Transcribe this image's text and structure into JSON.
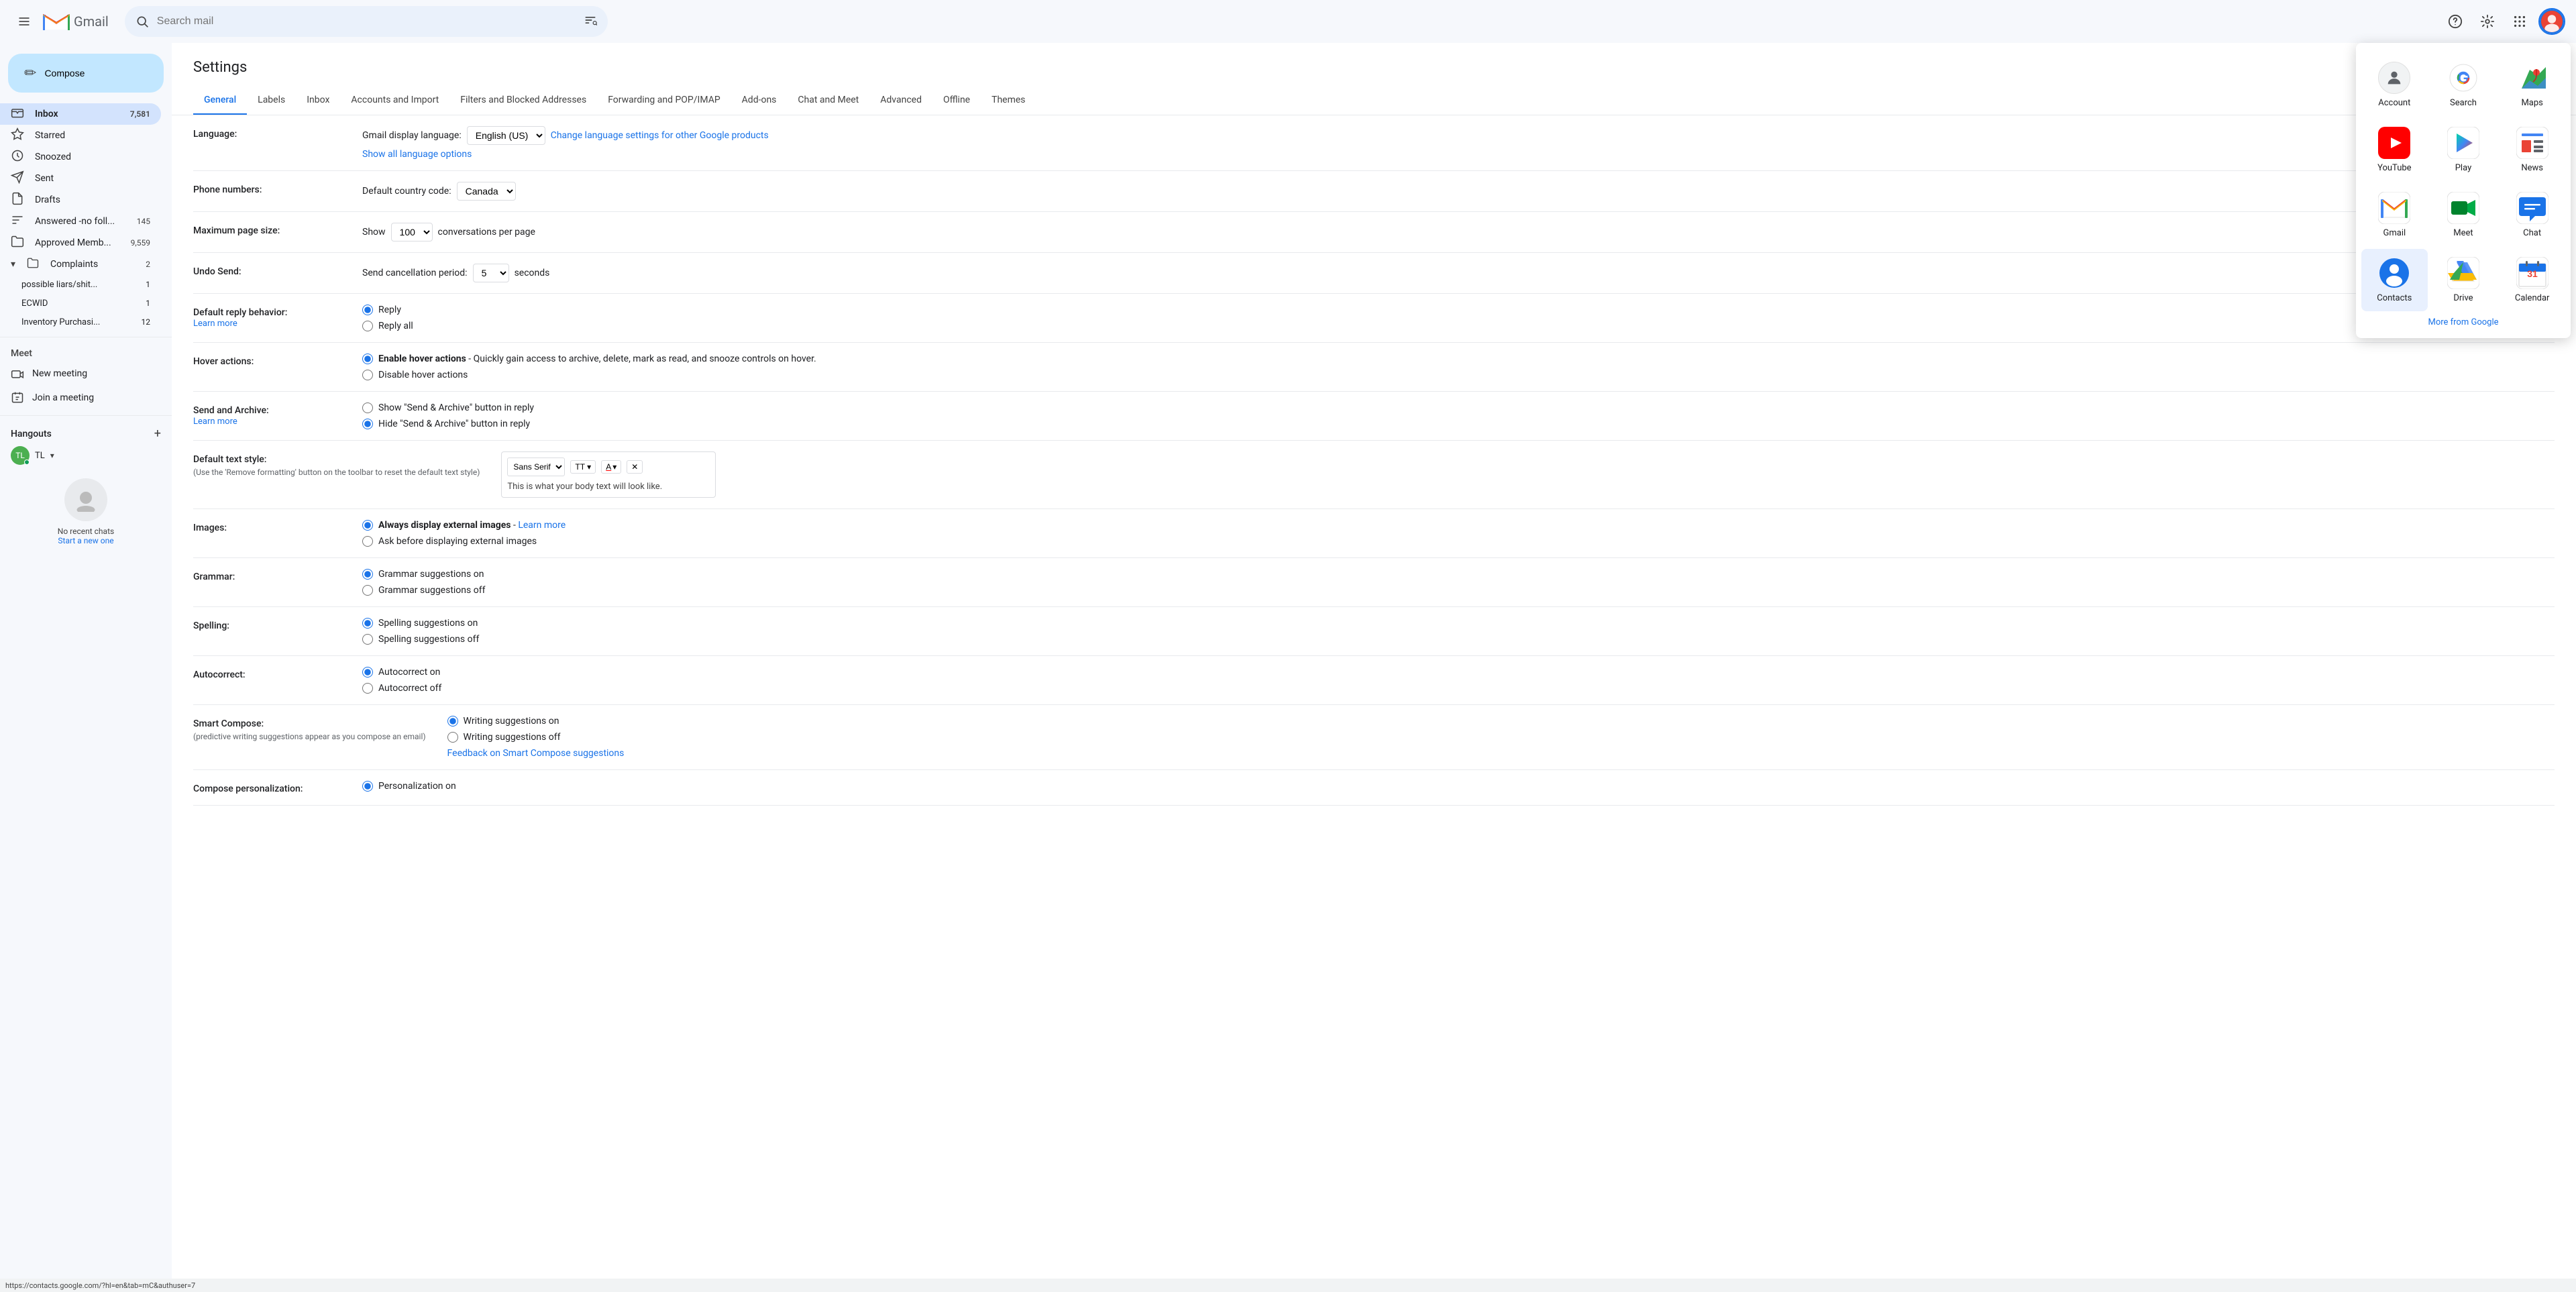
{
  "app": {
    "title": "Gmail",
    "status_bar": "https://contacts.google.com/?hl=en&tab=mC&authuser=7"
  },
  "topbar": {
    "search_placeholder": "Search mail",
    "menu_icon": "menu-icon",
    "logo_text": "Gmail"
  },
  "compose": {
    "label": "Compose"
  },
  "sidebar": {
    "nav_items": [
      {
        "label": "Inbox",
        "icon": "📥",
        "count": "7,581",
        "active": true
      },
      {
        "label": "Starred",
        "icon": "☆",
        "count": ""
      },
      {
        "label": "Snoozed",
        "icon": "🕐",
        "count": ""
      },
      {
        "label": "Sent",
        "icon": "▷",
        "count": ""
      },
      {
        "label": "Drafts",
        "icon": "📄",
        "count": ""
      },
      {
        "label": "Answered -no foll...",
        "icon": "📁",
        "count": "145"
      },
      {
        "label": "Approved Memb...",
        "icon": "📁",
        "count": "9,559"
      }
    ],
    "complaints": {
      "label": "Complaints",
      "count": "2",
      "children": [
        {
          "label": "possible liars/shit...",
          "count": "1"
        },
        {
          "label": "ECWID",
          "count": "1"
        },
        {
          "label": "Inventory Purchasi...",
          "count": "12"
        }
      ]
    },
    "meet_section": {
      "title": "Meet",
      "items": [
        {
          "label": "New meeting",
          "icon": "🎥"
        },
        {
          "label": "Join a meeting",
          "icon": "⌨"
        }
      ]
    },
    "hangouts_section": {
      "title": "Hangouts",
      "user": {
        "initials": "TL",
        "show_arrow": true
      },
      "add_icon": "+",
      "no_chats": "No recent chats",
      "start_new": "Start a new one"
    }
  },
  "settings": {
    "title": "Settings",
    "tabs": [
      {
        "label": "General",
        "active": true
      },
      {
        "label": "Labels"
      },
      {
        "label": "Inbox"
      },
      {
        "label": "Accounts and Import"
      },
      {
        "label": "Filters and Blocked Addresses"
      },
      {
        "label": "Forwarding and POP/IMAP"
      },
      {
        "label": "Add-ons"
      },
      {
        "label": "Chat and Meet"
      },
      {
        "label": "Advanced"
      },
      {
        "label": "Offline"
      },
      {
        "label": "Themes"
      }
    ],
    "rows": [
      {
        "label": "Language:",
        "type": "language",
        "display_label": "Gmail display language:",
        "value": "English (US)",
        "link1": "Change language settings for other Google products",
        "link2": "Show all language options"
      },
      {
        "label": "Phone numbers:",
        "type": "select",
        "display_label": "Default country code:",
        "value": "Canada"
      },
      {
        "label": "Maximum page size:",
        "type": "inline",
        "prefix": "Show",
        "value": "100",
        "suffix": "conversations per page"
      },
      {
        "label": "Undo Send:",
        "type": "inline",
        "prefix": "Send cancellation period:",
        "value": "5",
        "suffix": "seconds"
      },
      {
        "label": "Default reply behavior:",
        "type": "radio",
        "learn_more": true,
        "options": [
          {
            "label": "Reply",
            "checked": true
          },
          {
            "label": "Reply all",
            "checked": false
          }
        ]
      },
      {
        "label": "Hover actions:",
        "type": "radio",
        "options": [
          {
            "label": "Enable hover actions - Quickly gain access to archive, delete, mark as read, and snooze controls on hover.",
            "checked": true
          },
          {
            "label": "Disable hover actions",
            "checked": false
          }
        ]
      },
      {
        "label": "Send and Archive:",
        "type": "radio",
        "learn_more": true,
        "options": [
          {
            "label": "Show \"Send & Archive\" button in reply",
            "checked": false
          },
          {
            "label": "Hide \"Send & Archive\" button in reply",
            "checked": true
          }
        ]
      },
      {
        "label": "Default text style:",
        "sub_label": "(Use the 'Remove formatting' button on the toolbar to reset the default text style)",
        "type": "textstyle",
        "font": "Sans Serif",
        "preview": "This is what your body text will look like."
      },
      {
        "label": "Images:",
        "type": "radio",
        "options": [
          {
            "label": "Always display external images",
            "checked": true,
            "link": "Learn more"
          },
          {
            "label": "Ask before displaying external images",
            "checked": false
          }
        ]
      },
      {
        "label": "Grammar:",
        "type": "radio",
        "options": [
          {
            "label": "Grammar suggestions on",
            "checked": true
          },
          {
            "label": "Grammar suggestions off",
            "checked": false
          }
        ]
      },
      {
        "label": "Spelling:",
        "type": "radio",
        "options": [
          {
            "label": "Spelling suggestions on",
            "checked": true
          },
          {
            "label": "Spelling suggestions off",
            "checked": false
          }
        ]
      },
      {
        "label": "Autocorrect:",
        "type": "radio",
        "options": [
          {
            "label": "Autocorrect on",
            "checked": true
          },
          {
            "label": "Autocorrect off",
            "checked": false
          }
        ]
      },
      {
        "label": "Smart Compose:",
        "sub_label": "(predictive writing suggestions appear as you compose an email)",
        "type": "radio",
        "options": [
          {
            "label": "Writing suggestions on",
            "checked": true
          },
          {
            "label": "Writing suggestions off",
            "checked": false
          }
        ],
        "link": "Feedback on Smart Compose suggestions"
      },
      {
        "label": "Compose personalization:",
        "type": "radio",
        "options": [
          {
            "label": "Personalization on",
            "checked": true
          }
        ]
      }
    ]
  },
  "app_grid": {
    "visible": true,
    "items": [
      {
        "name": "Account",
        "icon_type": "account",
        "highlighted": false
      },
      {
        "name": "Search",
        "icon_type": "search",
        "highlighted": false
      },
      {
        "name": "Maps",
        "icon_type": "maps",
        "highlighted": false
      },
      {
        "name": "YouTube",
        "icon_type": "youtube",
        "highlighted": false
      },
      {
        "name": "Play",
        "icon_type": "play",
        "highlighted": false
      },
      {
        "name": "News",
        "icon_type": "news",
        "highlighted": false
      },
      {
        "name": "Gmail",
        "icon_type": "gmail",
        "highlighted": false
      },
      {
        "name": "Meet",
        "icon_type": "meet",
        "highlighted": false
      },
      {
        "name": "Chat",
        "icon_type": "chat",
        "highlighted": false
      },
      {
        "name": "Contacts",
        "icon_type": "contacts",
        "highlighted": true
      },
      {
        "name": "Drive",
        "icon_type": "drive",
        "highlighted": false
      },
      {
        "name": "Calendar",
        "icon_type": "calendar",
        "highlighted": false
      }
    ]
  },
  "colors": {
    "accent": "#1a73e8",
    "active_tab": "#1a73e8",
    "sidebar_active": "#d3e3fd"
  }
}
